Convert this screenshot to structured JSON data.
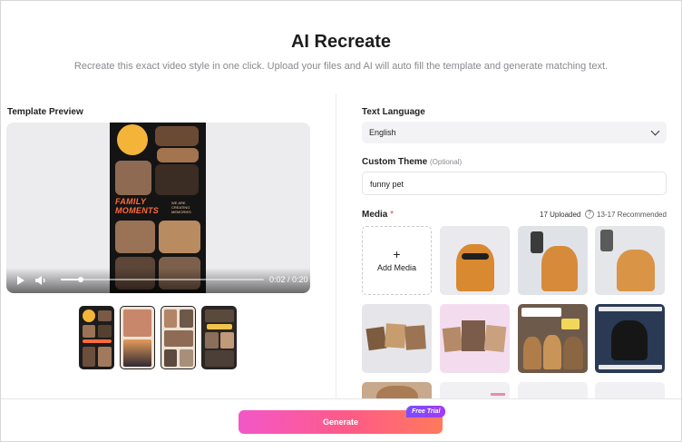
{
  "header": {
    "title": "AI Recreate",
    "subtitle": "Recreate this exact video style in one click. Upload your files and AI will auto fill the template and generate matching text."
  },
  "template_preview": {
    "label": "Template Preview",
    "poster_title_line1": "FAMILY",
    "poster_title_line2": "MOMENTS",
    "poster_caption": "WE ARE CREATING MEMORIES",
    "player": {
      "time": "0:02 / 0:20",
      "progress": 0.1
    },
    "thumbnails": [
      {
        "name": "family-moments"
      },
      {
        "name": "sunset"
      },
      {
        "name": "collage"
      },
      {
        "name": "daily-vlog"
      }
    ]
  },
  "form": {
    "text_language_label": "Text Language",
    "text_language_value": "English",
    "custom_theme_label": "Custom Theme",
    "custom_theme_optional": "(Optional)",
    "custom_theme_value": "funny pet",
    "media_label": "Media",
    "media_required": "*",
    "uploaded_count": "17 Uploaded",
    "recommended": "13-17 Recommended",
    "add_media_plus": "+",
    "add_media_label": "Add Media"
  },
  "footer": {
    "generate_label": "Generate",
    "trial_badge": "Free Trial"
  },
  "colors": {
    "accent_pink": "#f257c8",
    "accent_coral": "#ff7a5c",
    "badge_purple": "#7b4dff"
  }
}
